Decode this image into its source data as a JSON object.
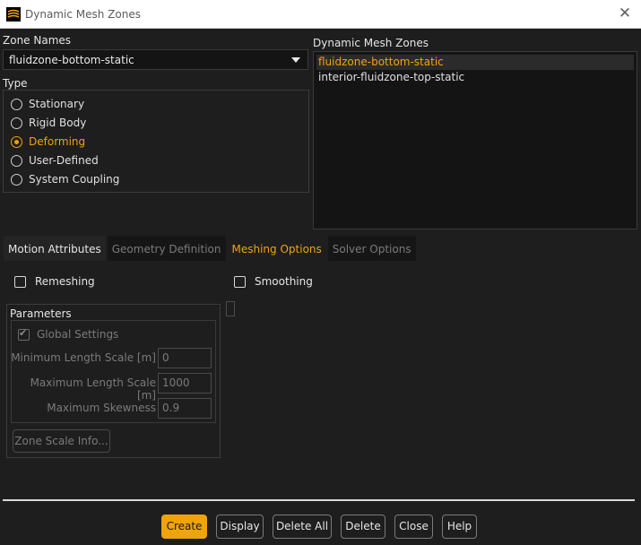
{
  "window": {
    "title": "Dynamic Mesh Zones",
    "close_glyph": "✕"
  },
  "zone_names": {
    "label": "Zone Names",
    "selected": "fluidzone-bottom-static"
  },
  "type": {
    "label": "Type",
    "options": [
      "Stationary",
      "Rigid Body",
      "Deforming",
      "User-Defined",
      "System Coupling"
    ],
    "selected": "Deforming"
  },
  "dynamic_mesh_zones": {
    "label": "Dynamic Mesh Zones",
    "items": [
      "fluidzone-bottom-static",
      "interior-fluidzone-top-static"
    ],
    "selected": "fluidzone-bottom-static"
  },
  "tabs": [
    "Motion Attributes",
    "Geometry Definition",
    "Meshing Options",
    "Solver Options"
  ],
  "active_tab": "Meshing Options",
  "meshing": {
    "remeshing_label": "Remeshing",
    "remeshing_checked": false,
    "smoothing_label": "Smoothing",
    "smoothing_checked": false
  },
  "parameters": {
    "title": "Parameters",
    "global_settings_label": "Global Settings",
    "global_settings_checked": true,
    "min_length_label": "Minimum Length Scale [m]",
    "min_length_value": "0",
    "max_length_label": "Maximum Length Scale [m]",
    "max_length_value": "1000",
    "max_skewness_label": "Maximum Skewness",
    "max_skewness_value": "0.9",
    "zone_scale_button": "Zone Scale Info..."
  },
  "buttons": {
    "create": "Create",
    "display": "Display",
    "delete_all": "Delete All",
    "delete": "Delete",
    "close": "Close",
    "help": "Help"
  },
  "colors": {
    "accent": "#f0a30a",
    "background": "#1e1e1e",
    "list_background": "#141414"
  }
}
